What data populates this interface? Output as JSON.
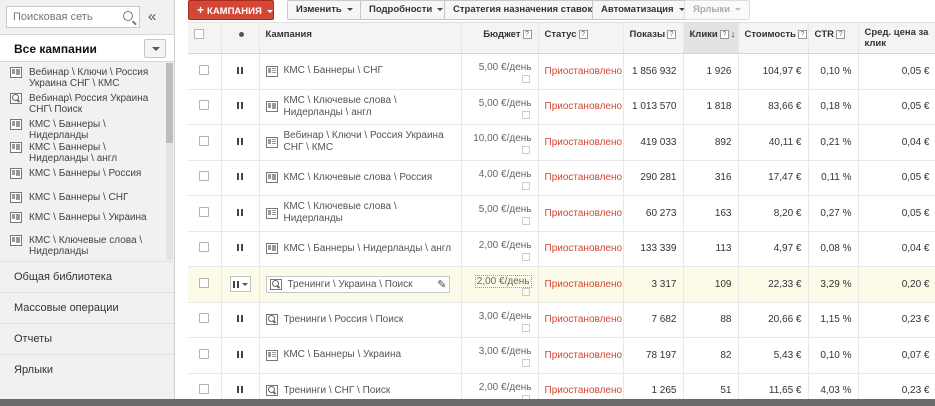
{
  "sidebar": {
    "search_placeholder": "Поисковая сеть",
    "collapse_glyph": "«",
    "all_campaigns_label": "Все кампании",
    "campaigns": [
      {
        "type": "display",
        "label": "Вебинар \\ Ключи \\ Россия Украина СНГ \\ КМС"
      },
      {
        "type": "search",
        "label": "Вебинар\\ Россия Украина СНГ\\ Поиск"
      },
      {
        "type": "display",
        "label": "КМС \\ Баннеры \\ Нидерланды"
      },
      {
        "type": "display",
        "label": "КМС \\ Баннеры \\ Нидерланды \\ англ"
      },
      {
        "type": "display",
        "label": "КМС \\ Баннеры \\ Россия"
      },
      {
        "type": "display",
        "label": "КМС \\ Баннеры \\ СНГ"
      },
      {
        "type": "display",
        "label": "КМС \\ Баннеры \\ Украина"
      },
      {
        "type": "display",
        "label": "КМС \\ Ключевые слова \\ Нидерланды"
      }
    ],
    "nav": [
      {
        "label": "Общая библиотека"
      },
      {
        "label": "Массовые операции"
      },
      {
        "label": "Отчеты"
      },
      {
        "label": "Ярлыки"
      }
    ]
  },
  "toolbar": {
    "campaign_label": "КАМПАНИЯ",
    "plus_glyph": "+",
    "edit_label": "Изменить",
    "details_label": "Подробности",
    "bid_strategy_label": "Стратегия назначения ставок",
    "automation_label": "Автоматизация",
    "labels_label": "Ярлыки"
  },
  "table": {
    "headers": {
      "campaign": "Кампания",
      "budget": "Бюджет",
      "status": "Статус",
      "impressions": "Показы",
      "clicks": "Клики",
      "cost": "Стоимость",
      "ctr": "CTR",
      "avg_cpc": "Сред. цена за клик",
      "help_glyph": "?",
      "sort_glyph": "↓"
    },
    "rows": [
      {
        "type": "display",
        "name": "КМС \\ Баннеры \\ СНГ",
        "budget": "5,00 €/день",
        "status": "Приостановлено",
        "impressions": "1 856 932",
        "clicks": "1 926",
        "cost": "104,97 €",
        "ctr": "0,10 %",
        "cpc": "0,05 €"
      },
      {
        "type": "display",
        "name": "КМС \\ Ключевые слова \\ Нидерланды \\ англ",
        "budget": "5,00 €/день",
        "status": "Приостановлено",
        "impressions": "1 013 570",
        "clicks": "1 818",
        "cost": "83,66 €",
        "ctr": "0,18 %",
        "cpc": "0,05 €"
      },
      {
        "type": "display",
        "name": "Вебинар \\ Ключи \\ Россия Украина СНГ \\ КМС",
        "budget": "10,00 €/день",
        "status": "Приостановлено",
        "impressions": "419 033",
        "clicks": "892",
        "cost": "40,11 €",
        "ctr": "0,21 %",
        "cpc": "0,04 €"
      },
      {
        "type": "display",
        "name": "КМС \\ Ключевые слова \\ Россия",
        "budget": "4,00 €/день",
        "status": "Приостановлено",
        "impressions": "290 281",
        "clicks": "316",
        "cost": "17,47 €",
        "ctr": "0,11 %",
        "cpc": "0,05 €"
      },
      {
        "type": "display",
        "name": "КМС \\ Ключевые слова \\ Нидерланды",
        "budget": "5,00 €/день",
        "status": "Приостановлено",
        "impressions": "60 273",
        "clicks": "163",
        "cost": "8,20 €",
        "ctr": "0,27 %",
        "cpc": "0,05 €"
      },
      {
        "type": "display",
        "name": "КМС \\ Баннеры \\ Нидерланды \\ англ",
        "budget": "2,00 €/день",
        "status": "Приостановлено",
        "impressions": "133 339",
        "clicks": "113",
        "cost": "4,97 €",
        "ctr": "0,08 %",
        "cpc": "0,04 €"
      },
      {
        "type": "search",
        "name": "Тренинги \\ Украина \\ Поиск",
        "budget": "2,00 €/день",
        "status": "Приостановлено",
        "impressions": "3 317",
        "clicks": "109",
        "cost": "22,33 €",
        "ctr": "3,29 %",
        "cpc": "0,20 €"
      },
      {
        "type": "search",
        "name": "Тренинги \\ Россия \\ Поиск",
        "budget": "3,00 €/день",
        "status": "Приостановлено",
        "impressions": "7 682",
        "clicks": "88",
        "cost": "20,66 €",
        "ctr": "1,15 %",
        "cpc": "0,23 €"
      },
      {
        "type": "display",
        "name": "КМС \\ Баннеры \\ Украина",
        "budget": "3,00 €/день",
        "status": "Приостановлено",
        "impressions": "78 197",
        "clicks": "82",
        "cost": "5,43 €",
        "ctr": "0,10 %",
        "cpc": "0,07 €"
      },
      {
        "type": "search",
        "name": "Тренинги \\ СНГ \\ Поиск",
        "budget": "2,00 €/день",
        "status": "Приостановлено",
        "impressions": "1 265",
        "clicks": "51",
        "cost": "11,65 €",
        "ctr": "4,03 %",
        "cpc": "0,23 €"
      }
    ]
  },
  "colors": {
    "accent": "#d14836",
    "status_paused": "#d14836",
    "highlight_row": "#fcfbe9"
  }
}
